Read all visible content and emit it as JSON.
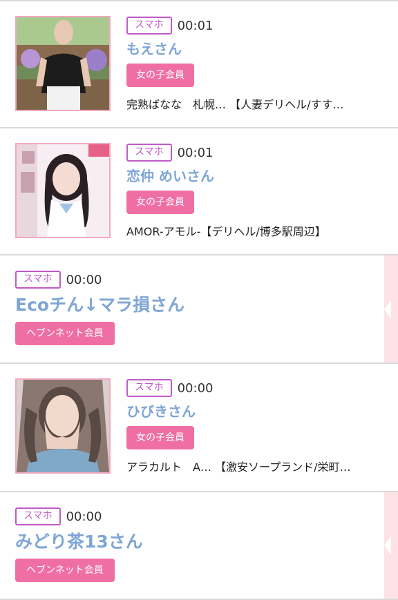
{
  "items": [
    {
      "device": "スマホ",
      "time": "00:01",
      "name": "もえさん",
      "badge": "女の子会員",
      "shop": "完熟ばなな　札幌… 【人妻デリヘル/すす…"
    },
    {
      "device": "スマホ",
      "time": "00:01",
      "name": "恋仲 めいさん",
      "badge": "女の子会員",
      "shop": "AMOR-アモル-【デリヘル/博多駅周辺】"
    },
    {
      "device": "スマホ",
      "time": "00:00",
      "name": "Ecoチん↓マラ損さん",
      "badge": "ヘブンネット会員"
    },
    {
      "device": "スマホ",
      "time": "00:00",
      "name": "ひびきさん",
      "badge": "女の子会員",
      "shop": "アラカルト　A… 【激安ソープランド/栄町…"
    },
    {
      "device": "スマホ",
      "time": "00:00",
      "name": "みどり茶13さん",
      "badge": "ヘブンネット会員"
    }
  ],
  "colors": {
    "accent_pink": "#ef6fa4",
    "device_purple": "#c05ac7",
    "name_blue": "#7ea5d6"
  }
}
